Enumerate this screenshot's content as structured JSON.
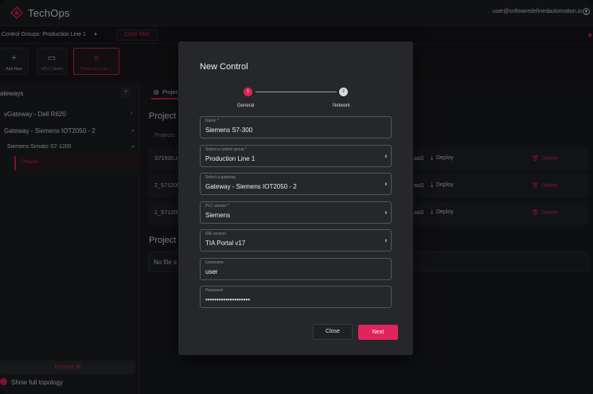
{
  "header": {
    "brand": "TechOps",
    "user_email": "user@softwaredefinedautomation.io",
    "logo_icon": "techops-logo-icon",
    "user_icon": "user-circle-icon"
  },
  "subbar": {
    "control_groups_label": "Control Groups: Production Line 1",
    "clear_filter": "Clear filter"
  },
  "toolbar": {
    "tiles": [
      {
        "label": "Add New",
        "icon": "+"
      },
      {
        "label": "vPLC Demo",
        "icon": "▭"
      },
      {
        "label": "Production Line 1",
        "icon": "≡"
      }
    ]
  },
  "sidebar": {
    "title": "ateways",
    "items": [
      {
        "label": "vGateway - Dell R620"
      },
      {
        "label": "Gateway - Siemens IOT2050 - 2"
      }
    ],
    "sub_item": "Siemens Simatic S7-1200",
    "selected": "Projects",
    "expand_all": "Expand all",
    "show_topology": "Show full topology"
  },
  "main": {
    "tab_label": "Projec",
    "heading": "Project l",
    "column_header": "Projects",
    "rows": [
      {
        "name": "S71500.z",
        "saas": "aaS",
        "deploy": "Deploy",
        "delete": "Delete"
      },
      {
        "name": "2_S71200",
        "saas": "aaS",
        "deploy": "Deploy",
        "delete": "Delete"
      },
      {
        "name": "1_S71200",
        "saas": "aaS",
        "deploy": "Deploy",
        "delete": "Delete"
      }
    ],
    "heading2": "Project u",
    "no_file": "No file s"
  },
  "modal": {
    "title": "New Control",
    "steps": [
      {
        "number": "1",
        "label": "General"
      },
      {
        "number": "2",
        "label": "Network"
      }
    ],
    "fields": {
      "name": {
        "label": "Name *",
        "value": "Siemens S7-300"
      },
      "control_group": {
        "label": "Select a control group *",
        "value": "Production Line 1"
      },
      "gateway": {
        "label": "Select a gateway",
        "value": "Gateway - Siemens IOT2050 - 2"
      },
      "plc_vendor": {
        "label": "PLC vendor *",
        "value": "Siemens"
      },
      "ide_version": {
        "label": "IDE version",
        "value": "TIA Portal v17"
      },
      "username": {
        "label": "Username",
        "value": "user"
      },
      "password": {
        "label": "Password",
        "value": "••••••••••••••••••••"
      }
    },
    "close_label": "Close",
    "next_label": "Next"
  },
  "colors": {
    "accent": "#e0245e",
    "background": "#1a1b1f",
    "modal": "#26272b"
  }
}
